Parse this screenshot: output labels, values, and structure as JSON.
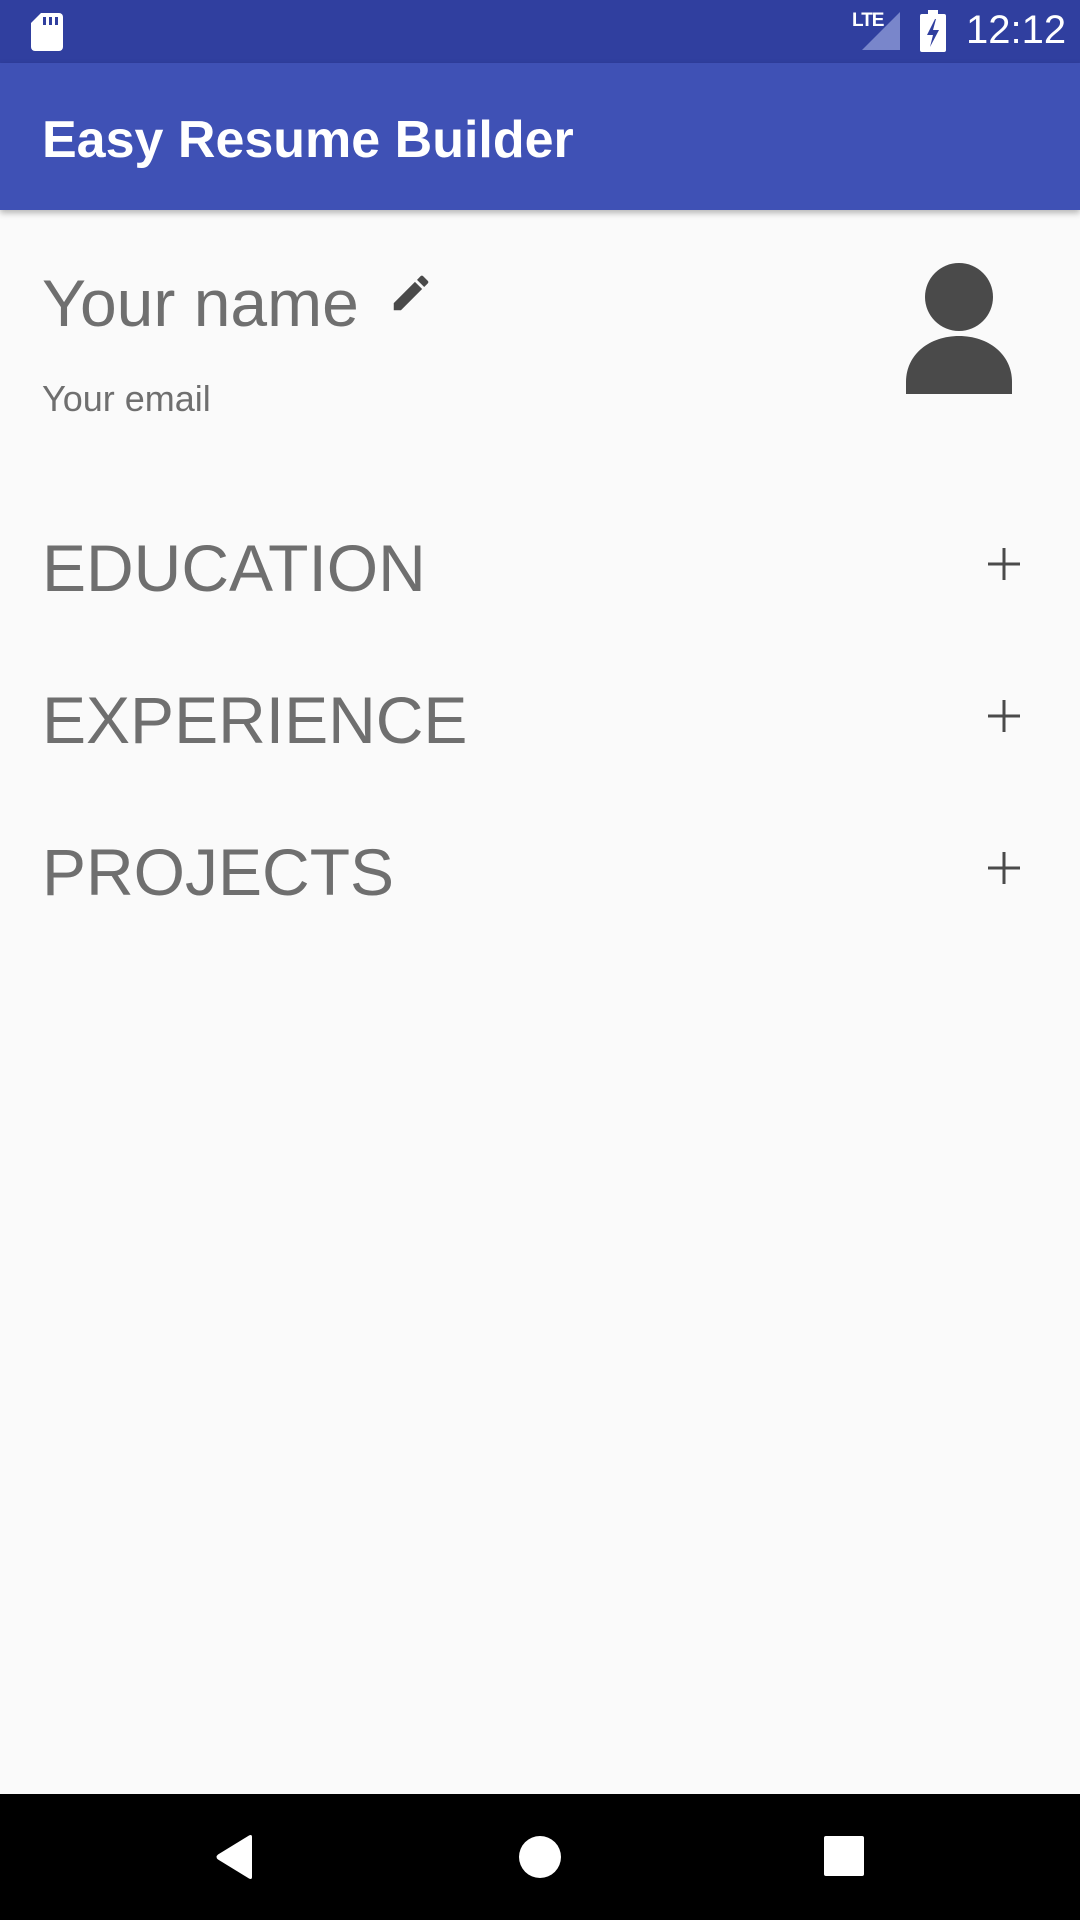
{
  "status_bar": {
    "network_label": "LTE",
    "time": "12:12",
    "icons": [
      "sd-card-icon",
      "signal-icon",
      "battery-charging-icon"
    ]
  },
  "app_bar": {
    "title": "Easy Resume Builder",
    "color": "#3f51b5",
    "status_color": "#303f9f"
  },
  "profile": {
    "name": "Your name",
    "email": "Your email",
    "edit_icon": "pencil-icon",
    "avatar_icon": "person-icon"
  },
  "sections": [
    {
      "label": "EDUCATION",
      "action_icon": "plus-icon"
    },
    {
      "label": "EXPERIENCE",
      "action_icon": "plus-icon"
    },
    {
      "label": "PROJECTS",
      "action_icon": "plus-icon"
    }
  ],
  "nav_bar": {
    "icons": [
      "back-icon",
      "home-icon",
      "recents-icon"
    ]
  },
  "colors": {
    "text_secondary": "#6f6f6f",
    "icon_dark": "#4a4a4a",
    "background": "#fafafa"
  }
}
